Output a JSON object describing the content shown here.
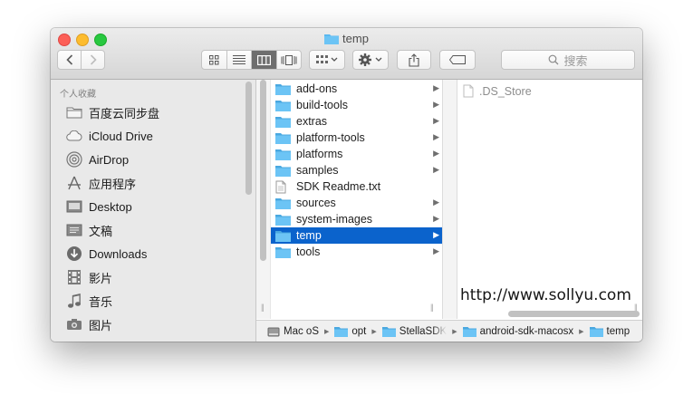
{
  "window": {
    "title": "temp",
    "controls": [
      "close",
      "minimize",
      "zoom"
    ]
  },
  "toolbar": {
    "back_icon": "chevron-left-icon",
    "forward_icon": "chevron-right-icon",
    "view_modes": [
      "icon-view",
      "list-view",
      "column-view",
      "coverflow-view"
    ],
    "active_view": "column-view",
    "search_placeholder": "搜索"
  },
  "sidebar": {
    "heading": "个人收藏",
    "items": [
      {
        "label": "百度云同步盘",
        "icon": "folder-icon"
      },
      {
        "label": "iCloud Drive",
        "icon": "cloud-icon"
      },
      {
        "label": "AirDrop",
        "icon": "airdrop-icon"
      },
      {
        "label": "应用程序",
        "icon": "applications-icon"
      },
      {
        "label": "Desktop",
        "icon": "desktop-icon"
      },
      {
        "label": "文稿",
        "icon": "document-icon"
      },
      {
        "label": "Downloads",
        "icon": "download-icon"
      },
      {
        "label": "影片",
        "icon": "film-icon"
      },
      {
        "label": "音乐",
        "icon": "music-icon"
      },
      {
        "label": "图片",
        "icon": "camera-icon"
      }
    ]
  },
  "column1": {
    "rows": [
      {
        "name": "add-ons",
        "type": "folder"
      },
      {
        "name": "build-tools",
        "type": "folder"
      },
      {
        "name": "extras",
        "type": "folder"
      },
      {
        "name": "platform-tools",
        "type": "folder"
      },
      {
        "name": "platforms",
        "type": "folder"
      },
      {
        "name": "samples",
        "type": "folder"
      },
      {
        "name": "SDK Readme.txt",
        "type": "file"
      },
      {
        "name": "sources",
        "type": "folder"
      },
      {
        "name": "system-images",
        "type": "folder"
      },
      {
        "name": "temp",
        "type": "folder",
        "selected": true
      },
      {
        "name": "tools",
        "type": "folder"
      }
    ]
  },
  "column3": {
    "items": [
      ".DS_Store"
    ]
  },
  "watermark": "http://www.sollyu.com",
  "pathbar": [
    "Mac oS",
    "opt",
    "StellaSDK",
    "android-sdk-macosx",
    "temp"
  ],
  "colors": {
    "selection": "#0b63cc",
    "folder": "#5ab8f0",
    "sidebar_bg": "#e9e9e9"
  }
}
